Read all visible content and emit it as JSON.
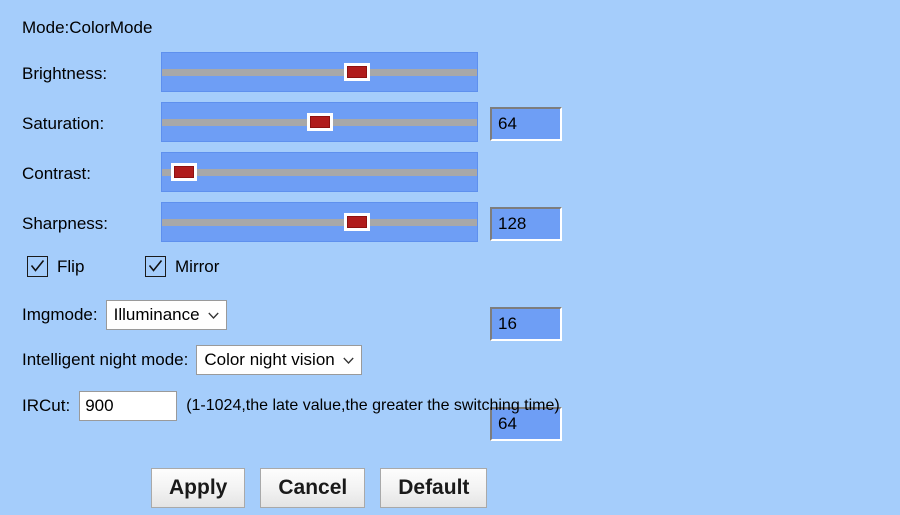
{
  "mode": {
    "title": "Mode:ColorMode"
  },
  "sliders": [
    {
      "label": "Brightness:",
      "value": "64",
      "percent": 62
    },
    {
      "label": "Saturation:",
      "value": "128",
      "percent": 50
    },
    {
      "label": "Contrast:",
      "value": "16",
      "percent": 7
    },
    {
      "label": "Sharpness:",
      "value": "64",
      "percent": 62
    }
  ],
  "checkboxes": [
    {
      "label": "Flip",
      "checked": true
    },
    {
      "label": "Mirror",
      "checked": true
    }
  ],
  "imgmode": {
    "label": "Imgmode:",
    "value": "Illuminance",
    "caret_icon": "chevron-down-icon"
  },
  "night_mode": {
    "label": "Intelligent night mode:",
    "value": "Color night vision",
    "caret_icon": "chevron-down-icon"
  },
  "ircut": {
    "label": "IRCut:",
    "value": "900",
    "placeholder": "",
    "hint": "(1-1024,the late value,the greater the switching time)"
  },
  "buttons": [
    {
      "label": "Apply"
    },
    {
      "label": "Cancel"
    },
    {
      "label": "Default"
    }
  ],
  "colors": {
    "background": "#a5cdfb",
    "slider_track": "#6e9ef5",
    "slider_rail": "#a8a8a8",
    "thumb_red": "#b01c1c",
    "value_box_fill": "#6e9ef5"
  }
}
